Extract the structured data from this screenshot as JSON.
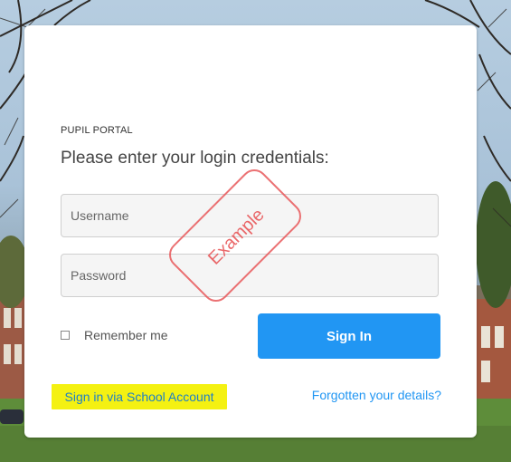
{
  "portal": {
    "label": "PUPIL PORTAL",
    "prompt": "Please enter your login credentials:"
  },
  "form": {
    "username_placeholder": "Username",
    "password_placeholder": "Password",
    "remember_label": "Remember me",
    "signin_label": "Sign In"
  },
  "links": {
    "school_account": "Sign in via School Account",
    "forgot": "Forgotten your details?"
  },
  "watermark": {
    "text": "Example",
    "color": "#e8585a"
  },
  "colors": {
    "accent": "#2196f3",
    "highlight": "#f4f112"
  }
}
